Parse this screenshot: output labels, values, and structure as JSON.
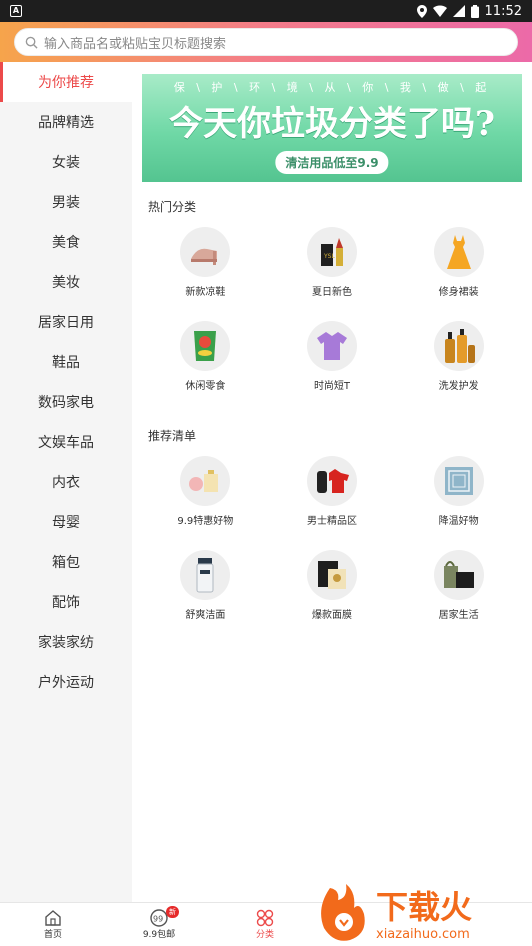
{
  "status": {
    "time": "11:52"
  },
  "search": {
    "placeholder": "输入商品名或粘贴宝贝标题搜索"
  },
  "sidebar": {
    "items": [
      {
        "label": "为你推荐"
      },
      {
        "label": "品牌精选"
      },
      {
        "label": "女装"
      },
      {
        "label": "男装"
      },
      {
        "label": "美食"
      },
      {
        "label": "美妆"
      },
      {
        "label": "居家日用"
      },
      {
        "label": "鞋品"
      },
      {
        "label": "数码家电"
      },
      {
        "label": "文娱车品"
      },
      {
        "label": "内衣"
      },
      {
        "label": "母婴"
      },
      {
        "label": "箱包"
      },
      {
        "label": "配饰"
      },
      {
        "label": "家装家纺"
      },
      {
        "label": "户外运动"
      }
    ]
  },
  "banner": {
    "subline": "保 \\ 护 \\ 环 \\ 境 \\ 从 \\ 你 \\ 我 \\ 做 \\ 起",
    "headline": "今天你垃圾分类了吗?",
    "pill": "清洁用品低至9.9"
  },
  "hot": {
    "title": "热门分类",
    "items": [
      {
        "label": "新款凉鞋",
        "icon": "sandal-icon"
      },
      {
        "label": "夏日新色",
        "icon": "lipstick-icon"
      },
      {
        "label": "修身裙装",
        "icon": "dress-icon"
      },
      {
        "label": "休闲零食",
        "icon": "chips-icon"
      },
      {
        "label": "时尚短T",
        "icon": "tshirt-icon"
      },
      {
        "label": "洗发护发",
        "icon": "shampoo-icon"
      }
    ]
  },
  "recommend": {
    "title": "推荐清单",
    "items": [
      {
        "label": "9.9特惠好物",
        "icon": "gift-icon"
      },
      {
        "label": "男士精品区",
        "icon": "shaver-icon"
      },
      {
        "label": "降温好物",
        "icon": "cooling-mat-icon"
      },
      {
        "label": "舒爽洁面",
        "icon": "cleanser-icon"
      },
      {
        "label": "爆款面膜",
        "icon": "mask-icon"
      },
      {
        "label": "居家生活",
        "icon": "home-goods-icon"
      }
    ]
  },
  "nav": {
    "items": [
      {
        "label": "首页"
      },
      {
        "label": "9.9包邮",
        "badge": "新"
      },
      {
        "label": "分类"
      }
    ]
  },
  "watermark": {
    "brand": "下载火",
    "url": "xiazaihuo.com"
  },
  "colors": {
    "accent": "#ec4a4a",
    "banner_green": "#54c490"
  }
}
